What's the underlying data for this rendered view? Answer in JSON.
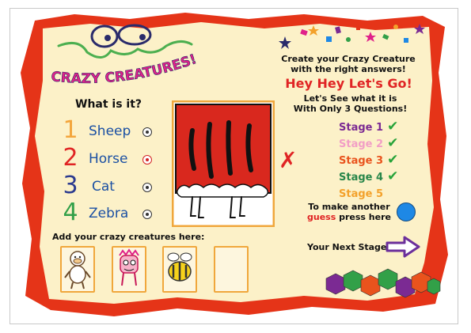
{
  "game": {
    "logo_text": "CRAZY CREATURES!",
    "intro_line1": "Create your Crazy Creature",
    "intro_line2": "with the right answers!",
    "headline": "Hey Hey Let's Go!",
    "sub_line1": "Let's See what it is",
    "sub_line2": "With Only 3 Questions!"
  },
  "question": {
    "prompt": "What is it?",
    "options": [
      {
        "number": "1",
        "label": "Sheep",
        "selected": false,
        "color": "#f3a53b"
      },
      {
        "number": "2",
        "label": "Horse",
        "selected": true,
        "color": "#e02424"
      },
      {
        "number": "3",
        "label": "Cat",
        "selected": false,
        "color": "#2c3b8f"
      },
      {
        "number": "4",
        "label": "Zebra",
        "selected": false,
        "color": "#32a048"
      }
    ],
    "result_mark": "✗"
  },
  "stages": [
    {
      "label": "Stage 1",
      "color": "#7b2a93",
      "completed": true
    },
    {
      "label": "Stage 2",
      "color": "#f29ec6",
      "completed": true
    },
    {
      "label": "Stage 3",
      "color": "#e9531d",
      "completed": true
    },
    {
      "label": "Stage 4",
      "color": "#28864a",
      "completed": true
    },
    {
      "label": "Stage 5",
      "color": "#f3a12b",
      "completed": false
    }
  ],
  "guess": {
    "line1": "To make another",
    "line2_highlight": "guess",
    "line2_rest": " press here"
  },
  "next_stage_label": "Your Next Stage",
  "creatures": {
    "label": "Add your crazy creatures here:",
    "slots": [
      {
        "icon": "monkey-icon"
      },
      {
        "icon": "crazy-creature-icon"
      },
      {
        "icon": "bee-icon"
      },
      {
        "icon": "empty-slot"
      }
    ]
  },
  "colors": {
    "parchment": "#fcf1c8",
    "border_red": "#e53418",
    "accent_blue": "#1e88e5",
    "arrow_purple": "#6b2f9b"
  }
}
